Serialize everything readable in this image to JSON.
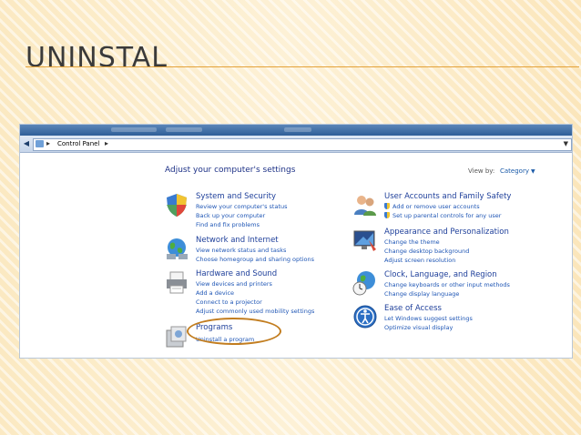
{
  "slide": {
    "title": "UNINSTAL"
  },
  "window": {
    "breadcrumb": "Control Panel",
    "heading": "Adjust your computer's settings",
    "view_by_label": "View by:",
    "view_by_value": "Category"
  },
  "categories": [
    {
      "title": "System and Security",
      "links": [
        "Review your computer's status",
        "Back up your computer",
        "Find and fix problems"
      ],
      "icon": "shield-icon"
    },
    {
      "title": "Network and Internet",
      "links": [
        "View network status and tasks",
        "Choose homegroup and sharing options"
      ],
      "icon": "network-globe-icon"
    },
    {
      "title": "Hardware and Sound",
      "links": [
        "View devices and printers",
        "Add a device",
        "Connect to a projector",
        "Adjust commonly used mobility settings"
      ],
      "icon": "printer-icon"
    },
    {
      "title": "Programs",
      "links": [
        "Uninstall a program"
      ],
      "icon": "programs-icon"
    },
    {
      "title": "User Accounts and Family Safety",
      "links": [
        "Add or remove user accounts",
        "Set up parental controls for any user"
      ],
      "icon": "users-icon"
    },
    {
      "title": "Appearance and Personalization",
      "links": [
        "Change the theme",
        "Change desktop background",
        "Adjust screen resolution"
      ],
      "icon": "monitor-icon"
    },
    {
      "title": "Clock, Language, and Region",
      "links": [
        "Change keyboards or other input methods",
        "Change display language"
      ],
      "icon": "clock-globe-icon"
    },
    {
      "title": "Ease of Access",
      "links": [
        "Let Windows suggest settings",
        "Optimize visual display"
      ],
      "icon": "ease-of-access-icon"
    }
  ],
  "colors": {
    "accent_rule": "#e4a23a",
    "link": "#1f56b5",
    "highlight_circle": "#c27d1f"
  }
}
